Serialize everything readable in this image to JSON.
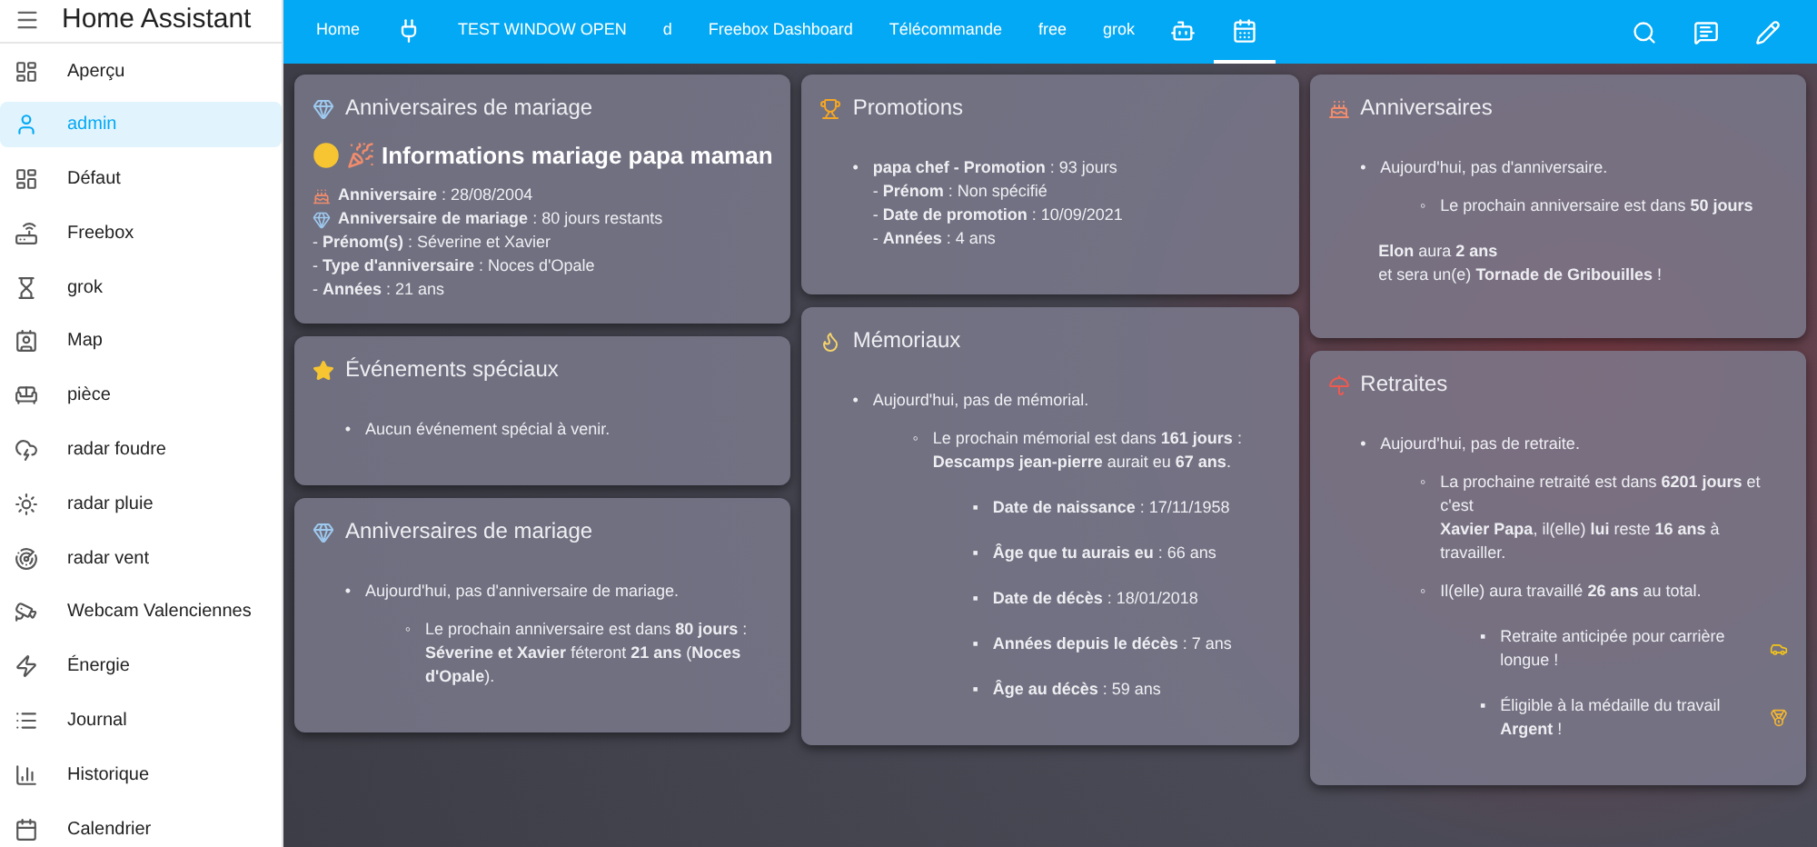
{
  "sidebar": {
    "title": "Home Assistant",
    "items": [
      {
        "label": "Aperçu",
        "selected": false
      },
      {
        "label": "admin",
        "selected": true
      },
      {
        "label": "Défaut",
        "selected": false
      },
      {
        "label": "Freebox",
        "selected": false
      },
      {
        "label": "grok",
        "selected": false
      },
      {
        "label": "Map",
        "selected": false
      },
      {
        "label": "pièce",
        "selected": false
      },
      {
        "label": "radar foudre",
        "selected": false
      },
      {
        "label": "radar pluie",
        "selected": false
      },
      {
        "label": "radar vent",
        "selected": false
      },
      {
        "label": "Webcam Valenciennes",
        "selected": false
      },
      {
        "label": "Énergie",
        "selected": false
      },
      {
        "label": "Journal",
        "selected": false
      },
      {
        "label": "Historique",
        "selected": false
      },
      {
        "label": "Calendrier",
        "selected": false
      }
    ]
  },
  "tabs": [
    {
      "kind": "text",
      "label": "Home",
      "selected": false
    },
    {
      "kind": "plug",
      "selected": false
    },
    {
      "kind": "text",
      "label": "TEST WINDOW OPEN",
      "selected": false
    },
    {
      "kind": "text",
      "label": "d",
      "selected": false
    },
    {
      "kind": "text",
      "label": "Freebox Dashboard",
      "selected": false
    },
    {
      "kind": "text",
      "label": "Télécommande",
      "selected": false
    },
    {
      "kind": "text",
      "label": "free",
      "selected": false
    },
    {
      "kind": "text",
      "label": "grok",
      "selected": false
    },
    {
      "kind": "robot",
      "selected": false
    },
    {
      "kind": "calendar",
      "selected": true
    }
  ],
  "columns": [
    [
      {
        "kind": "ring",
        "title": "Anniversaires de mariage",
        "heading": "Informations mariage papa maman",
        "lines": [
          {
            "kind": "cake",
            "text": "**Anniversaire** : 28/08/2004"
          },
          {
            "kind": "ring",
            "text": "**Anniversaire de mariage** : 80 jours restants"
          },
          {
            "kind": "plain",
            "text": "- **Prénom(s)** : Séverine et Xavier"
          },
          {
            "kind": "plain",
            "text": "- **Type d'anniversaire** : Noces d'Opale"
          },
          {
            "kind": "plain",
            "text": "- **Années** : 21 ans"
          }
        ]
      },
      {
        "kind": "star",
        "title": "Événements spéciaux",
        "bullets": [
          {
            "marker": "•",
            "text": "Aucun événement spécial à venir."
          }
        ]
      },
      {
        "kind": "ring",
        "title": "Anniversaires de mariage",
        "bullets": [
          {
            "marker": "•",
            "text": "Aujourd'hui, pas d'anniversaire de mariage.",
            "children": [
              {
                "marker": "◦",
                "text": "Le prochain anniversaire est dans **80 jours** :\n**Séverine et Xavier** féteront **21 ans** (**Noces d'Opale**)."
              }
            ]
          }
        ]
      }
    ],
    [
      {
        "kind": "trophy",
        "title": "Promotions",
        "bullets": [
          {
            "marker": "•",
            "text": "**papa chef - Promotion** : 93 jours",
            "lines": [
              "- **Prénom** : Non spécifié",
              "- **Date de promotion** : 10/09/2021",
              "- **Années** : 4 ans"
            ]
          }
        ]
      },
      {
        "kind": "candle",
        "title": "Mémoriaux",
        "bullets": [
          {
            "marker": "•",
            "text": "Aujourd'hui, pas de mémorial.",
            "children": [
              {
                "marker": "◦",
                "text": "Le prochain mémorial est dans **161 jours** :\n**Descamps jean-pierre** aurait eu **67 ans**.",
                "children": [
                  {
                    "marker": "▪",
                    "text": "**Date de naissance** : 17/11/1958"
                  },
                  {
                    "marker": "▪",
                    "text": "**Âge que tu aurais eu** : 66 ans"
                  },
                  {
                    "marker": "▪",
                    "text": "**Date de décès** : 18/01/2018"
                  },
                  {
                    "marker": "▪",
                    "text": "**Années depuis le décès** : 7 ans"
                  },
                  {
                    "marker": "▪",
                    "text": "**Âge au décès** : 59 ans"
                  }
                ]
              }
            ]
          }
        ]
      }
    ],
    [
      {
        "kind": "cake",
        "title": "Anniversaires",
        "bullets": [
          {
            "marker": "•",
            "text": "Aujourd'hui, pas d'anniversaire.",
            "children": [
              {
                "marker": "◦",
                "text": "Le prochain anniversaire est dans **50 jours**"
              }
            ]
          }
        ],
        "note": "**Elon** aura **2 ans**\net sera un(e) **Tornade de Gribouilles** !"
      },
      {
        "kind": "umbrella",
        "title": "Retraites",
        "bullets": [
          {
            "marker": "•",
            "text": "Aujourd'hui, pas de retraite.",
            "children": [
              {
                "marker": "◦",
                "text": "La prochaine retraité est dans **6201 jours** et c'est\n**Xavier Papa**, il(elle) **lui** reste **16 ans** à travailler."
              },
              {
                "marker": "◦",
                "text": "Il(elle) aura travaillé **26 ans** au total.",
                "children": [
                  {
                    "marker": "▪",
                    "kind": "car",
                    "text": "Retraite anticipée pour carrière longue !"
                  },
                  {
                    "marker": "▪",
                    "kind": "medal",
                    "text": "Éligible à la médaille du travail **Argent** !"
                  }
                ]
              }
            ]
          }
        ]
      }
    ]
  ]
}
